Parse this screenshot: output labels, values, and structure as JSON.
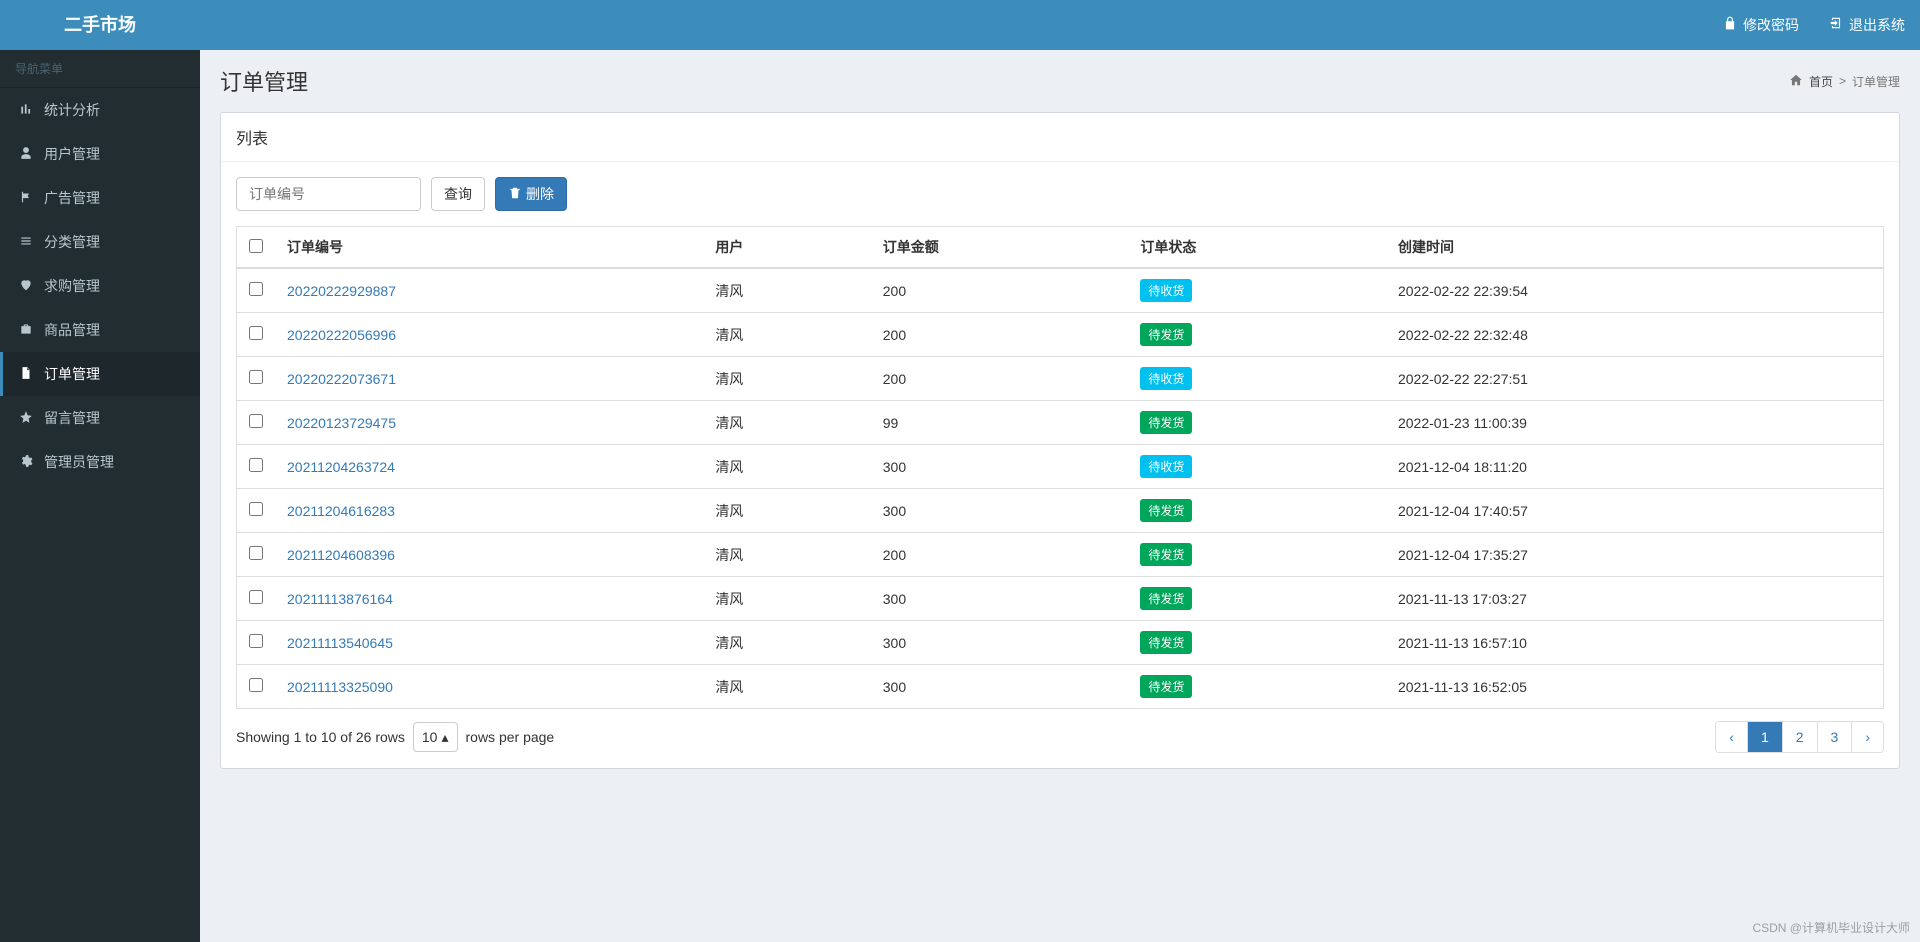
{
  "brand": "二手市场",
  "topbar": {
    "change_pwd": "修改密码",
    "logout": "退出系统"
  },
  "sidebar": {
    "header": "导航菜单",
    "items": [
      {
        "icon": "bar-chart",
        "label": "统计分析"
      },
      {
        "icon": "user",
        "label": "用户管理"
      },
      {
        "icon": "flag",
        "label": "广告管理"
      },
      {
        "icon": "list",
        "label": "分类管理"
      },
      {
        "icon": "heart",
        "label": "求购管理"
      },
      {
        "icon": "briefcase",
        "label": "商品管理"
      },
      {
        "icon": "file",
        "label": "订单管理"
      },
      {
        "icon": "star",
        "label": "留言管理"
      },
      {
        "icon": "cog",
        "label": "管理员管理"
      }
    ],
    "active_index": 6
  },
  "page": {
    "title": "订单管理",
    "breadcrumb_home": "首页",
    "breadcrumb_sep": ">",
    "breadcrumb_current": "订单管理"
  },
  "panel": {
    "title": "列表",
    "search_placeholder": "订单编号",
    "search_btn": "查询",
    "delete_btn": "删除"
  },
  "table": {
    "columns": [
      "订单编号",
      "用户",
      "订单金额",
      "订单状态",
      "创建时间"
    ],
    "rows": [
      {
        "id": "20220222929887",
        "user": "清风",
        "amount": "200",
        "status": "待收货",
        "status_type": "info",
        "time": "2022-02-22 22:39:54"
      },
      {
        "id": "20220222056996",
        "user": "清风",
        "amount": "200",
        "status": "待发货",
        "status_type": "success",
        "time": "2022-02-22 22:32:48"
      },
      {
        "id": "20220222073671",
        "user": "清风",
        "amount": "200",
        "status": "待收货",
        "status_type": "info",
        "time": "2022-02-22 22:27:51"
      },
      {
        "id": "20220123729475",
        "user": "清风",
        "amount": "99",
        "status": "待发货",
        "status_type": "success",
        "time": "2022-01-23 11:00:39"
      },
      {
        "id": "20211204263724",
        "user": "清风",
        "amount": "300",
        "status": "待收货",
        "status_type": "info",
        "time": "2021-12-04 18:11:20"
      },
      {
        "id": "20211204616283",
        "user": "清风",
        "amount": "300",
        "status": "待发货",
        "status_type": "success",
        "time": "2021-12-04 17:40:57"
      },
      {
        "id": "20211204608396",
        "user": "清风",
        "amount": "200",
        "status": "待发货",
        "status_type": "success",
        "time": "2021-12-04 17:35:27"
      },
      {
        "id": "20211113876164",
        "user": "清风",
        "amount": "300",
        "status": "待发货",
        "status_type": "success",
        "time": "2021-11-13 17:03:27"
      },
      {
        "id": "20211113540645",
        "user": "清风",
        "amount": "300",
        "status": "待发货",
        "status_type": "success",
        "time": "2021-11-13 16:57:10"
      },
      {
        "id": "20211113325090",
        "user": "清风",
        "amount": "300",
        "status": "待发货",
        "status_type": "success",
        "time": "2021-11-13 16:52:05"
      }
    ]
  },
  "footer": {
    "showing_text": "Showing 1 to 10 of 26 rows",
    "rows_select": "10",
    "rows_per_page": "rows per page",
    "pages": [
      "‹",
      "1",
      "2",
      "3",
      "›"
    ],
    "active_page": "1"
  },
  "watermark": "CSDN @计算机毕业设计大师"
}
